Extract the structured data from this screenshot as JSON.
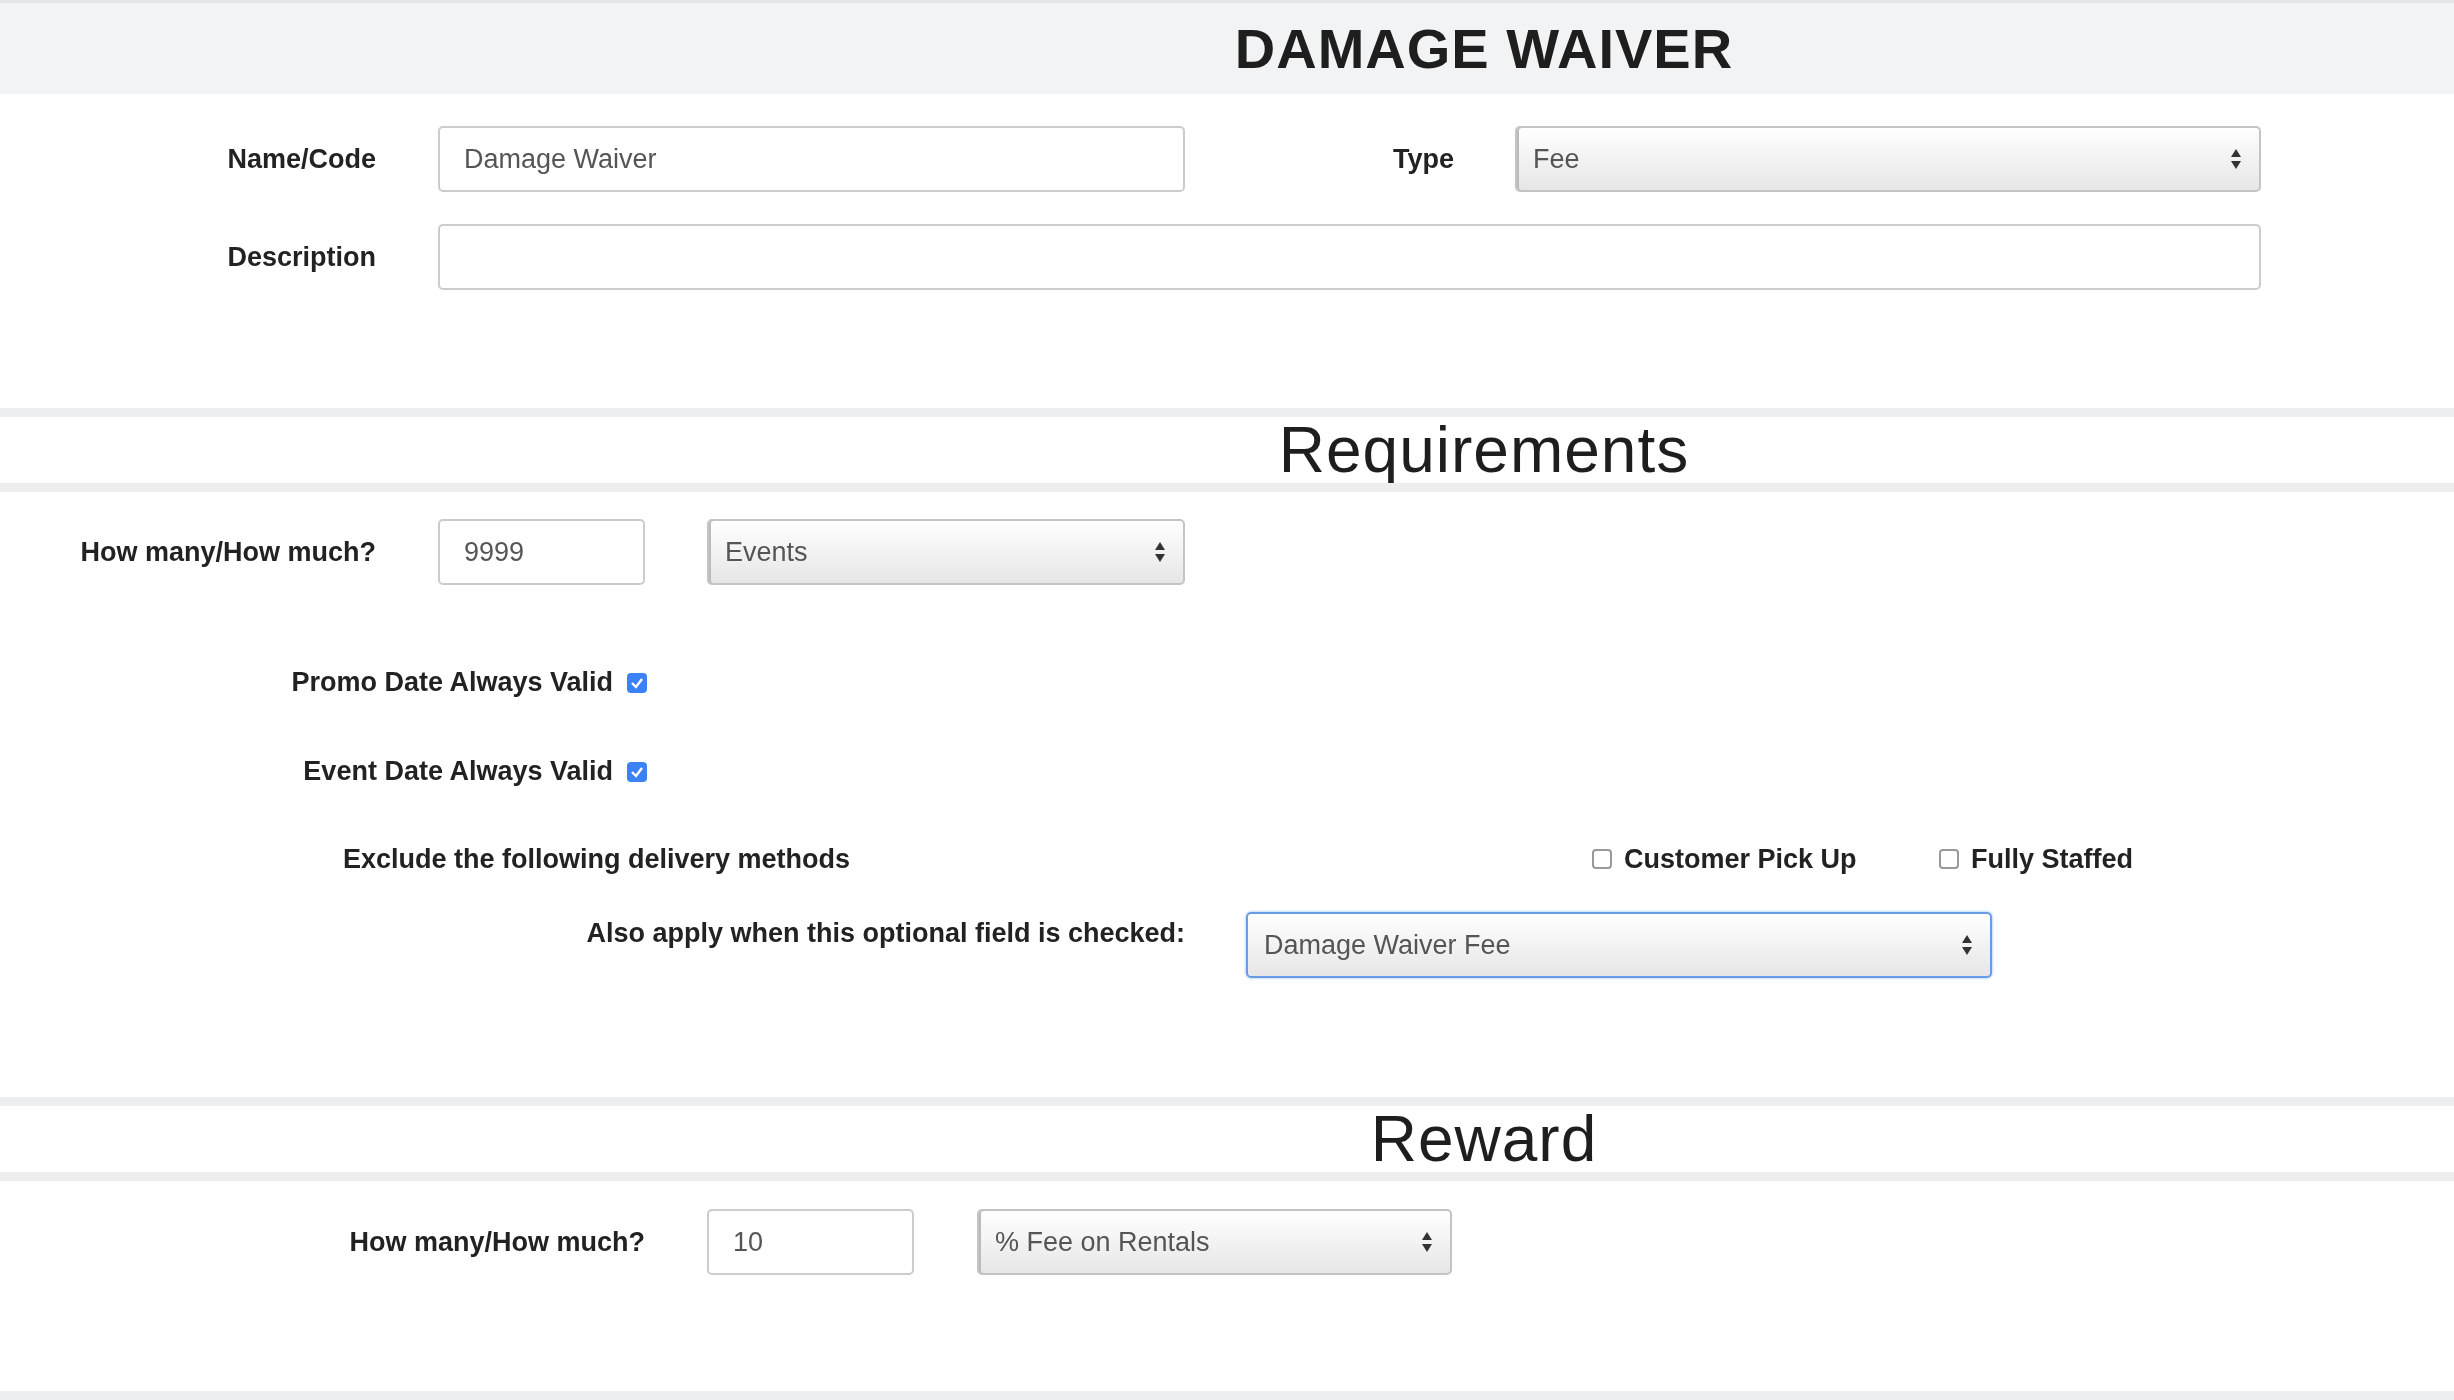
{
  "header": {
    "title": "DAMAGE WAIVER"
  },
  "details": {
    "name_code": {
      "label": "Name/Code",
      "value": "Damage Waiver"
    },
    "type": {
      "label": "Type",
      "value": "Fee",
      "focused": false
    },
    "description": {
      "label": "Description"
    }
  },
  "requirements": {
    "heading": "Requirements",
    "amount": {
      "label": "How many/How much?",
      "value": "9999",
      "unit": {
        "value": "Events",
        "focused": false
      }
    },
    "flags": [
      {
        "label": "Promo Date Always Valid",
        "checked": true
      },
      {
        "label": "Event Date Always Valid",
        "checked": true
      }
    ],
    "exclude": {
      "label": "Exclude the following delivery methods",
      "options": [
        {
          "label": "Customer Pick Up",
          "checked": false
        },
        {
          "label": "Fully Staffed",
          "checked": false
        }
      ]
    },
    "optional_field": {
      "label": "Also apply when this optional field is checked:",
      "value": "Damage Waiver Fee",
      "focused": true
    }
  },
  "reward": {
    "heading": "Reward",
    "amount": {
      "label": "How many/How much?",
      "value": "10",
      "unit": {
        "value": "% Fee on Rentals",
        "focused": false
      }
    }
  }
}
